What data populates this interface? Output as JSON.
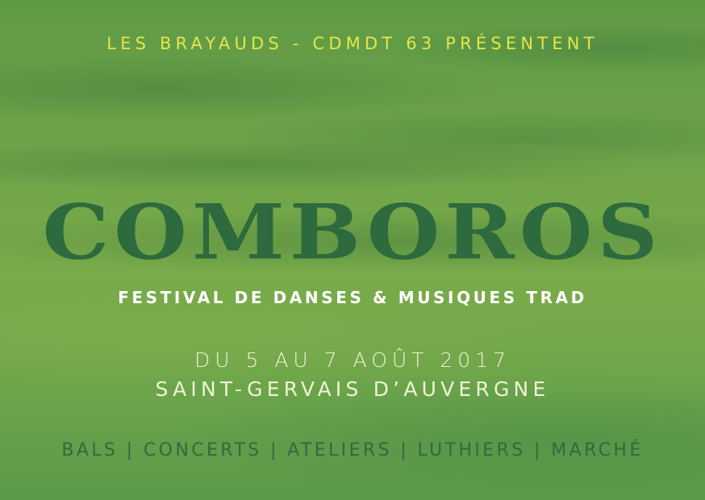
{
  "presenters": "LES BRAYAUDS - CDMDT 63 PRÉSENTENT",
  "title": "COMBOROS",
  "subtitle": "FESTIVAL DE DANSES & MUSIQUES TRAD",
  "dates": "DU 5 AU 7 AOÛT 2017",
  "location": "SAINT-GERVAIS D’AUVERGNE",
  "activities": "BALS | CONCERTS | ATELIERS | LUTHIERS | MARCHÉ",
  "colors": {
    "accent_yellow": "#e3e64c",
    "title_green": "#2d6a3d",
    "background": "#6ea348"
  }
}
